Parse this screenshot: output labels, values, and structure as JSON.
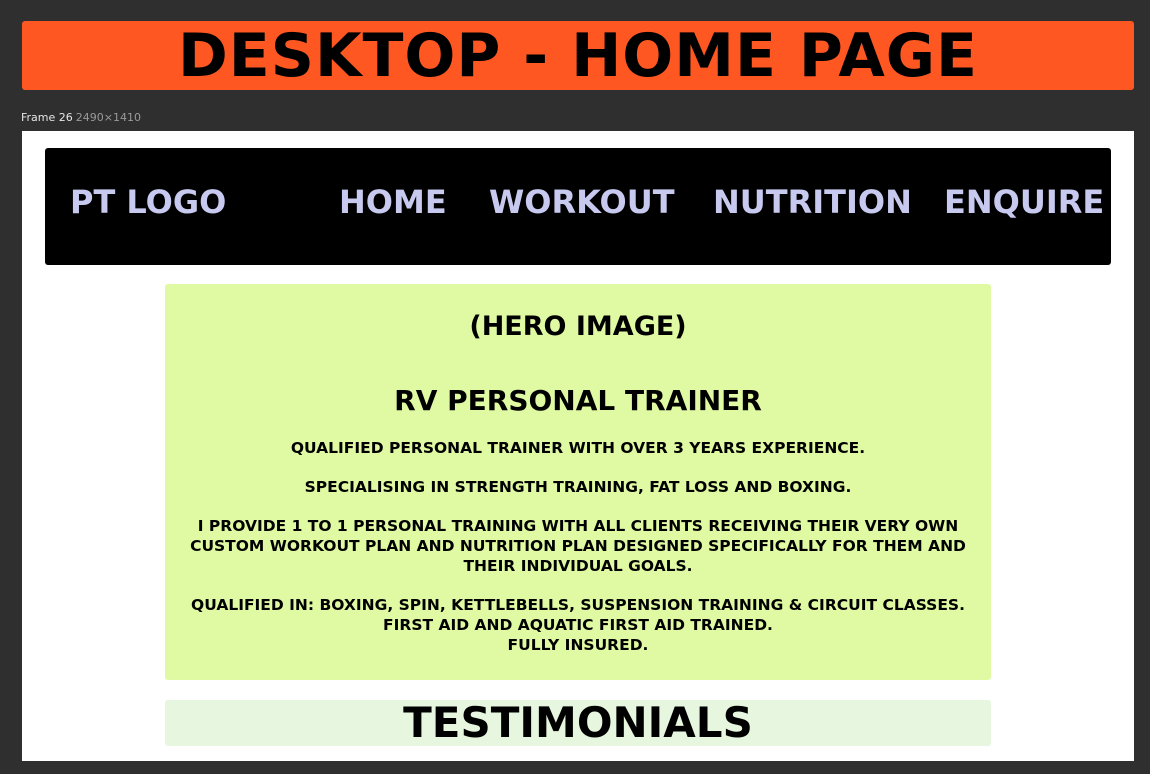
{
  "banner": {
    "title": "DESKTOP - HOME PAGE",
    "bg_color": "#ff5722"
  },
  "frame": {
    "name": "Frame 26",
    "dimensions": "2490×1410"
  },
  "navbar": {
    "logo": "PT LOGO",
    "links": [
      "HOME",
      "WORKOUT",
      "NUTRITION",
      "ENQUIRE"
    ],
    "text_color": "#c7c9ee",
    "bg_color": "#000000"
  },
  "hero": {
    "bg_color": "#dffaa2",
    "image_placeholder": "(HERO IMAGE)",
    "heading": "RV PERSONAL TRAINER",
    "paragraphs": [
      "QUALIFIED PERSONAL TRAINER WITH OVER 3 YEARS EXPERIENCE.",
      "SPECIALISING IN STRENGTH TRAINING, FAT LOSS AND BOXING.",
      "I PROVIDE 1 TO 1 PERSONAL TRAINING WITH ALL CLIENTS RECEIVING THEIR VERY OWN CUSTOM WORKOUT PLAN AND NUTRITION PLAN DESIGNED SPECIFICALLY FOR THEM AND THEIR INDIVIDUAL GOALS.",
      "QUALIFIED IN: BOXING, SPIN, KETTLEBELLS, SUSPENSION TRAINING & CIRCUIT CLASSES.",
      "FIRST AID AND AQUATIC FIRST AID TRAINED.",
      "FULLY INSURED."
    ]
  },
  "testimonials": {
    "title": "TESTIMONIALS",
    "bg_color": "#e7f6df"
  }
}
